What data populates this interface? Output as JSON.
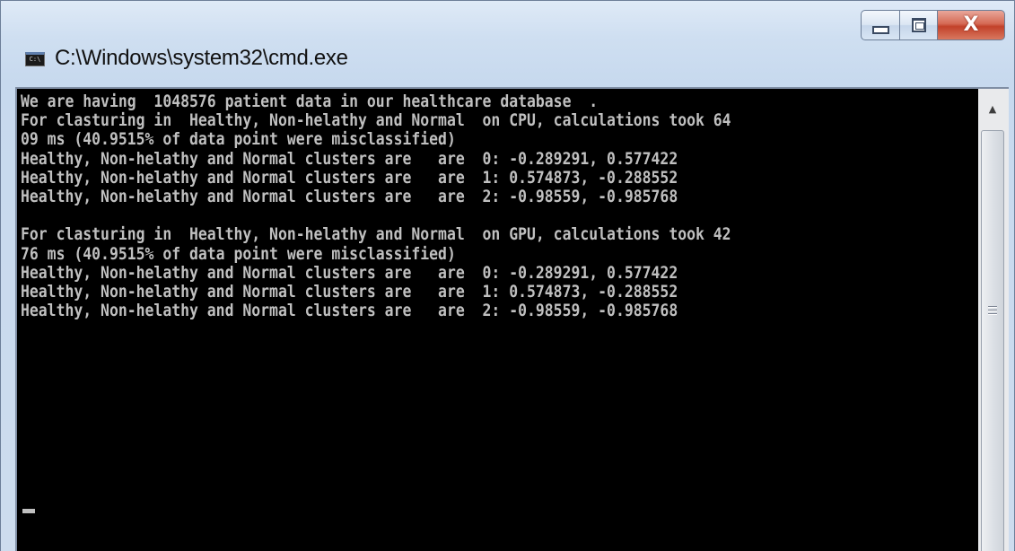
{
  "window": {
    "title": "C:\\Windows\\system32\\cmd.exe",
    "app_icon_text": "C:\\",
    "controls": {
      "minimize": "minimize",
      "maximize": "maximize",
      "close": "X"
    }
  },
  "console": {
    "lines": [
      "We are having  1048576 patient data in our healthcare database  .",
      "For clasturing in  Healthy, Non-helathy and Normal  on CPU, calculations took 64",
      "09 ms (40.9515% of data point were misclassified)",
      "Healthy, Non-helathy and Normal clusters are   are  0: -0.289291, 0.577422",
      "Healthy, Non-helathy and Normal clusters are   are  1: 0.574873, -0.288552",
      "Healthy, Non-helathy and Normal clusters are   are  2: -0.98559, -0.985768",
      "",
      "For clasturing in  Healthy, Non-helathy and Normal  on GPU, calculations took 42",
      "76 ms (40.9515% of data point were misclassified)",
      "Healthy, Non-helathy and Normal clusters are   are  0: -0.289291, 0.577422",
      "Healthy, Non-helathy and Normal clusters are   are  1: 0.574873, -0.288552",
      "Healthy, Non-helathy and Normal clusters are   are  2: -0.98559, -0.985768"
    ]
  },
  "scrollbar": {
    "up_arrow": "▲"
  },
  "colors": {
    "console_background": "#000000",
    "console_text": "#c0c0c0",
    "close_button": "#c2412a"
  }
}
